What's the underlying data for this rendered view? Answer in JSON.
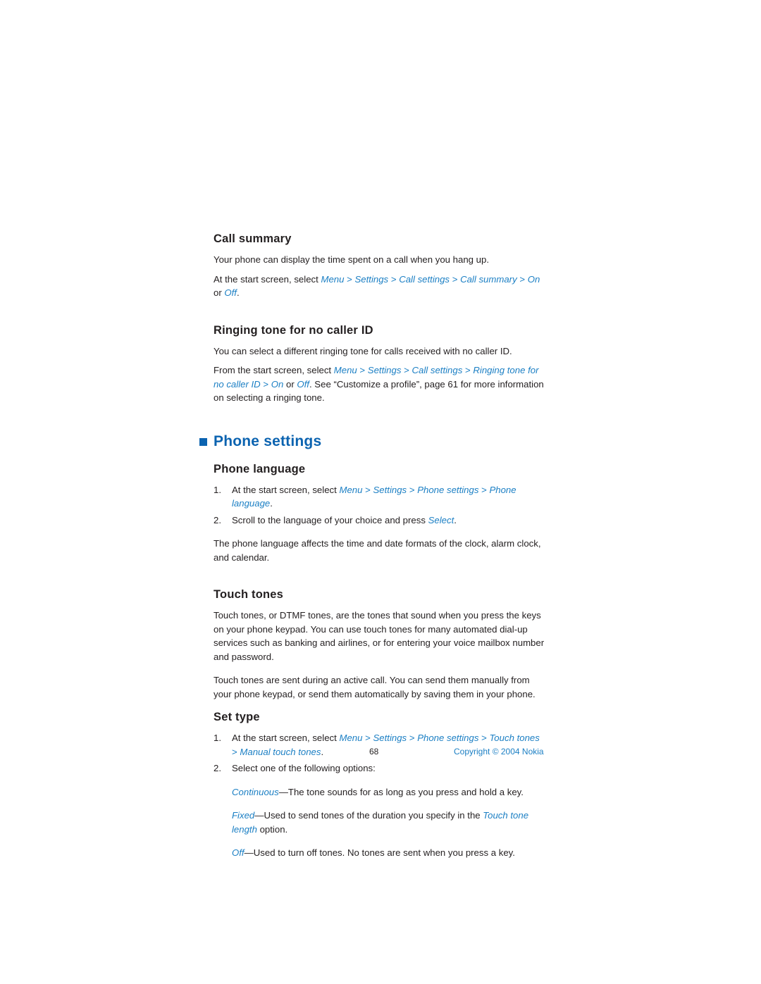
{
  "page": {
    "folio": "68",
    "copyright": "Copyright © 2004 Nokia"
  },
  "sections": {
    "call_summary": {
      "heading": "Call summary",
      "para1": "Your phone can display the time spent on a call when you hang up.",
      "para2_lead": "At the start screen, select ",
      "menu": "Menu",
      "settings": "Settings",
      "call_settings": "Call settings",
      "call_summary": "Call summary",
      "on": "On",
      "or": " or ",
      "off": "Off",
      "period": "."
    },
    "ringing_tone": {
      "heading": "Ringing tone for no caller ID",
      "para1": "You can select a different ringing tone for calls received with no caller ID.",
      "para2_lead": "From the start screen, select ",
      "menu": "Menu",
      "settings": "Settings",
      "call_settings": "Call settings",
      "ringing_tone_for_no_caller_id": "Ringing tone for no caller ID",
      "on": "On",
      "or": " or ",
      "off": "Off",
      "tail": ". See “Customize a profile”, page 61 for more information on selecting a ringing tone."
    },
    "phone_settings": {
      "heading": "Phone settings"
    },
    "phone_language": {
      "heading": "Phone language",
      "step1_lead": "At the start screen, select ",
      "menu": "Menu",
      "settings": "Settings",
      "phone_settings": "Phone settings",
      "phone_language": "Phone language",
      "step1_tail": ".",
      "step2_lead": "Scroll to the language of your choice and press ",
      "select": "Select",
      "step2_tail": ".",
      "para": "The phone language affects the time and date formats of the clock, alarm clock, and calendar."
    },
    "touch_tones": {
      "heading": "Touch tones",
      "para1": "Touch tones, or DTMF tones, are the tones that sound when you press the keys on your phone keypad. You can use touch tones for many automated dial-up services such as banking and airlines, or for entering your voice mailbox number and password.",
      "para2": "Touch tones are sent during an active call. You can send them manually from your phone keypad, or send them automatically by saving them in your phone."
    },
    "set_type": {
      "heading": "Set type",
      "step1_lead": "At the start screen, select ",
      "menu": "Menu",
      "settings": "Settings",
      "phone_settings": "Phone settings",
      "touch_tones": "Touch tones",
      "manual_touch_tones": "Manual touch tones",
      "step1_tail": ".",
      "step2": "Select one of the following options:",
      "opt1_term": "Continuous",
      "opt1_text": "—The tone sounds for as long as you press and hold a key.",
      "opt2_term": "Fixed",
      "opt2_text_a": "—Used to send tones of the duration you specify in the ",
      "opt2_link": "Touch tone length",
      "opt2_text_b": " option.",
      "opt3_term": "Off",
      "opt3_text": "—Used to turn off tones. No tones are sent when you press a key."
    }
  },
  "numbers": {
    "one": "1.",
    "two": "2."
  },
  "separators": {
    "gt": " > "
  }
}
